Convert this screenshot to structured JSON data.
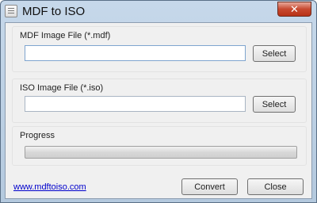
{
  "window": {
    "title": "MDF to ISO",
    "close_glyph": "✕",
    "app_icon": "document-icon"
  },
  "mdf_group": {
    "label": "MDF Image File (*.mdf)",
    "value": "",
    "select_label": "Select"
  },
  "iso_group": {
    "label": "ISO Image File (*.iso)",
    "value": "",
    "select_label": "Select"
  },
  "progress": {
    "label": "Progress",
    "percent": 0
  },
  "footer": {
    "link_text": "www.mdftoiso.com",
    "convert_label": "Convert",
    "close_label": "Close"
  }
}
